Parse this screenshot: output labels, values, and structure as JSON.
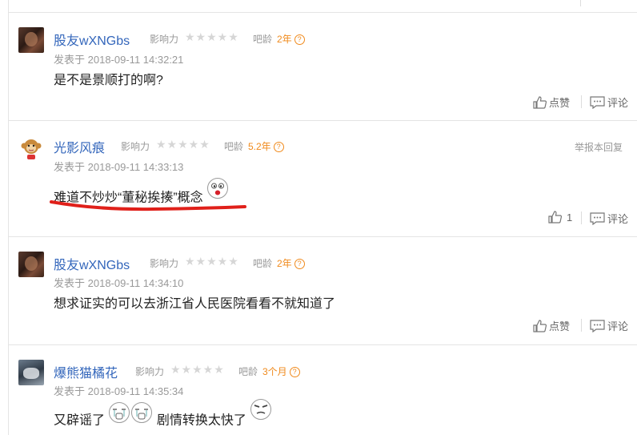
{
  "meta_labels": {
    "influence": "影响力",
    "bar_age": "吧龄",
    "posted_prefix": "发表于",
    "like": "点赞",
    "comment": "评论",
    "report": "举报本回复"
  },
  "comments": [
    {
      "user": "股友wXNGbs",
      "bar_age": "2年",
      "time": "2018-09-11 14:32:21",
      "text": "是不是景顺打的啊?",
      "likes": "点赞"
    },
    {
      "user": "光影风痕",
      "bar_age": "5.2年",
      "time": "2018-09-11 14:33:13",
      "text": "难道不炒炒“董秘挨揍”概念",
      "likes": "1"
    },
    {
      "user": "股友wXNGbs",
      "bar_age": "2年",
      "time": "2018-09-11 14:34:10",
      "text": "想求证实的可以去浙江省人民医院看看不就知道了",
      "likes": "点赞"
    },
    {
      "user": "爆熊猫橘花",
      "bar_age": "3个月",
      "time": "2018-09-11 14:35:34",
      "text_a": "又辟谣了",
      "text_b": "剧情转换太快了"
    }
  ],
  "icons": [
    "thumbs-up-icon",
    "comment-icon",
    "question-icon",
    "star-icon",
    "shocked-emoji-icon",
    "crying-emoji-icon",
    "annoyed-emoji-icon"
  ],
  "colors": {
    "username": "#3366bb",
    "bar_age": "#f08a1c",
    "underline": "#e0201a"
  }
}
